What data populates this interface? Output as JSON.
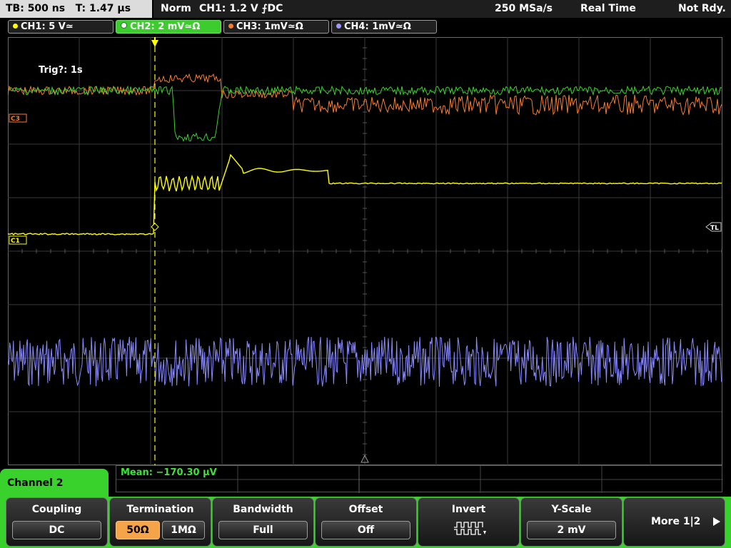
{
  "topbar": {
    "timebase": "TB: 500 ns",
    "trigger_time": "T: 1.47 µs",
    "mode": "Norm",
    "trigger_info": "CH1: 1.2 V ⨍DC",
    "sample_rate": "250 MSa/s",
    "acq_mode": "Real Time",
    "status": "Not Rdy."
  },
  "channels": [
    {
      "label": "CH1: 5 V≃",
      "color": "#ffff00",
      "active": false
    },
    {
      "label": "CH2: 2 mV≃Ω",
      "color": "#39d12c",
      "active": true
    },
    {
      "label": "CH3: 1mV≃Ω",
      "color": "#f47c30",
      "active": false
    },
    {
      "label": "CH4: 1mV≃Ω",
      "color": "#9a9aff",
      "active": false
    }
  ],
  "graticule": {
    "trigger_countdown": "Trig?: 1s",
    "marker_c1": "C1",
    "marker_c3": "C3",
    "marker_tl": "TL"
  },
  "bottom": {
    "active_channel": "Channel 2",
    "measurement": "Mean: −170.30 µV",
    "softkeys": {
      "coupling": {
        "title": "Coupling",
        "value": "DC"
      },
      "termination": {
        "title": "Termination",
        "opt1": "50Ω",
        "opt2": "1MΩ"
      },
      "bandwidth": {
        "title": "Bandwidth",
        "value": "Full"
      },
      "offset": {
        "title": "Offset",
        "value": "Off"
      },
      "invert": {
        "title": "Invert"
      },
      "yscale": {
        "title": "Y-Scale",
        "value": "2 mV"
      },
      "more": {
        "title": "More 1|2"
      }
    }
  }
}
